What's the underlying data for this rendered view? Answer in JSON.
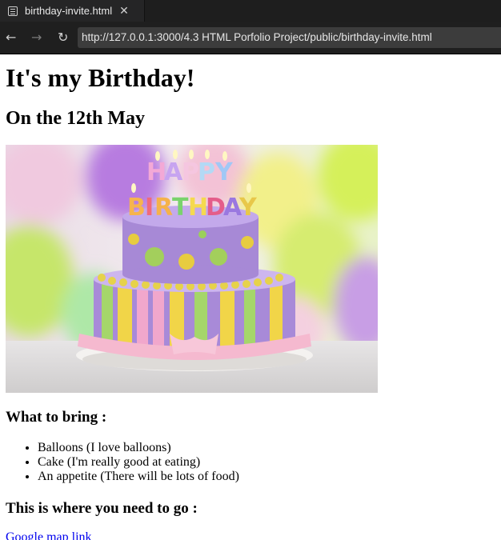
{
  "browser": {
    "tab_title": "birthday-invite.html",
    "tab_close": "✕",
    "back_glyph": "←",
    "forward_glyph": "→",
    "reload_glyph": "↻",
    "url": "http://127.0.0.1:3000/4.3 HTML Porfolio Project/public/birthday-invite.html"
  },
  "page": {
    "heading": "It's my Birthday!",
    "subheading": "On the 12th May",
    "cake_text": "HAPPY BIRTHDAY",
    "bring_heading": "What to bring :",
    "items": [
      "Balloons (I love balloons)",
      "Cake (I'm really good at eating)",
      "An appetite (There will be lots of food)"
    ],
    "go_heading": "This is where you need to go :",
    "map_link": "Google map link"
  }
}
